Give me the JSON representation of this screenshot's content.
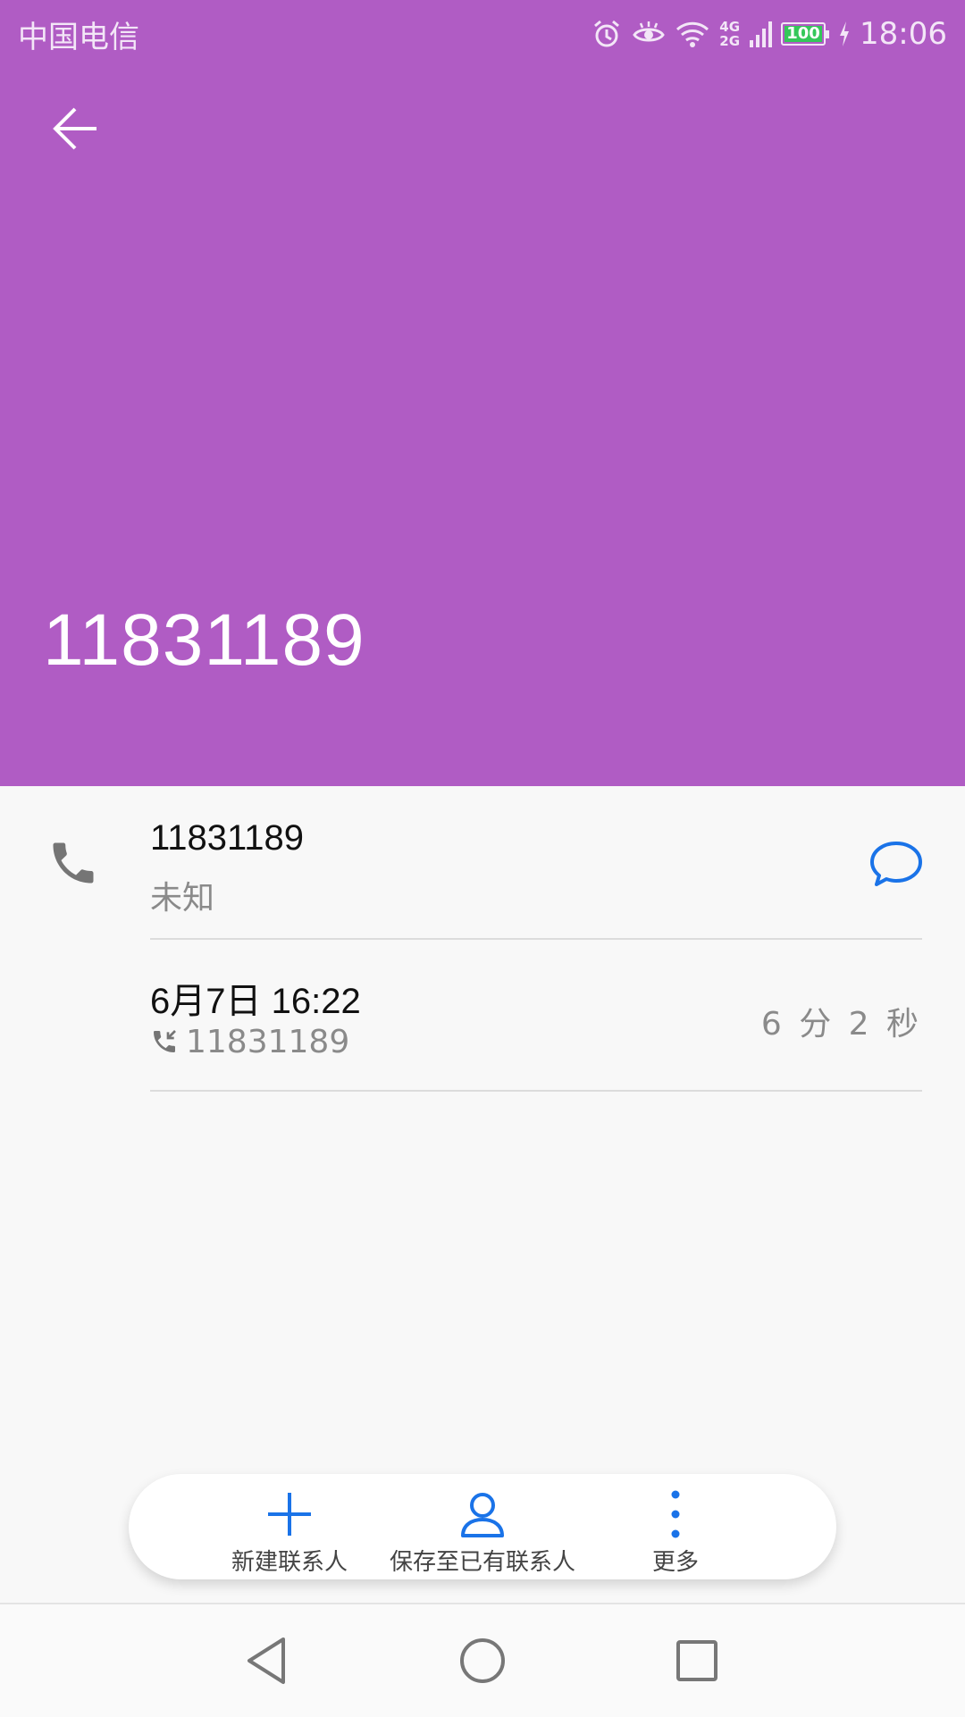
{
  "status_bar": {
    "carrier": "中国电信",
    "network_top": "4G",
    "network_bottom": "2G",
    "battery": "100",
    "time": "18:06"
  },
  "header": {
    "title_number": "11831189",
    "background_color": "#b05cc4"
  },
  "contact_row": {
    "number": "11831189",
    "label": "未知",
    "icons": [
      "phone-icon",
      "message-icon"
    ]
  },
  "call_log": [
    {
      "datetime": "6月7日 16:22",
      "number": "11831189",
      "duration": "6 分 2 秒",
      "icon": "incoming-call-icon"
    }
  ],
  "actions": [
    {
      "label": "新建联系人",
      "icon": "plus-icon"
    },
    {
      "label": "保存至已有联系人",
      "icon": "person-icon"
    },
    {
      "label": "更多",
      "icon": "more-vertical-icon"
    }
  ],
  "accent_color": "#1a73e8",
  "nav": [
    "back-icon",
    "home-icon",
    "recents-icon"
  ]
}
